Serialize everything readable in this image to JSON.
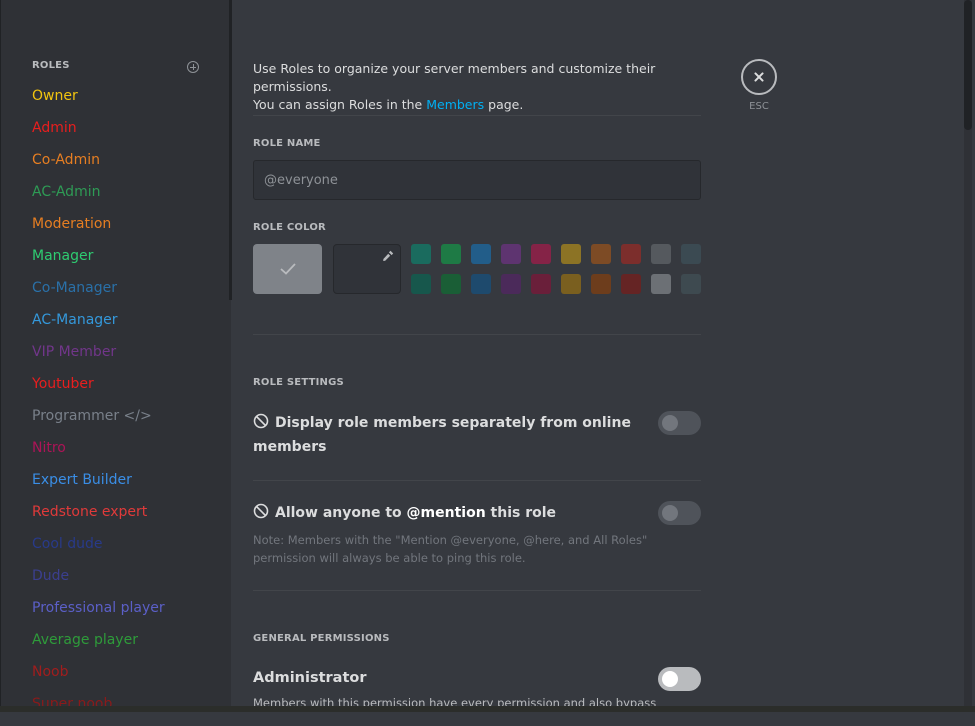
{
  "sidebar": {
    "header": "ROLES",
    "roles": [
      {
        "name": "Owner",
        "color": "#f1c40f"
      },
      {
        "name": "Admin",
        "color": "#e91e1e"
      },
      {
        "name": "Co-Admin",
        "color": "#e67e22"
      },
      {
        "name": "AC-Admin",
        "color": "#2e9b55"
      },
      {
        "name": "Moderation",
        "color": "#e67e22"
      },
      {
        "name": "Manager",
        "color": "#2ecc71"
      },
      {
        "name": "Co-Manager",
        "color": "#2a70a8"
      },
      {
        "name": "AC-Manager",
        "color": "#3498db"
      },
      {
        "name": "VIP Member",
        "color": "#71368a"
      },
      {
        "name": "Youtuber",
        "color": "#e91e1e"
      },
      {
        "name": "Programmer </>",
        "color": "#79808a"
      },
      {
        "name": "Nitro",
        "color": "#ad1457"
      },
      {
        "name": "Expert Builder",
        "color": "#3a8ee6"
      },
      {
        "name": "Redstone expert",
        "color": "#e03a3a"
      },
      {
        "name": "Cool dude",
        "color": "#283a8a"
      },
      {
        "name": "Dude",
        "color": "#3b3f8f"
      },
      {
        "name": "Professional player",
        "color": "#5b5fc7"
      },
      {
        "name": "Average player",
        "color": "#2e9b3a"
      },
      {
        "name": "Noob",
        "color": "#a11d1d"
      },
      {
        "name": "Super noob",
        "color": "#8a1a1a"
      }
    ]
  },
  "intro": {
    "line1": "Use Roles to organize your server members and customize their permissions.",
    "line2_pre": "You can assign Roles in the ",
    "link": "Members",
    "line2_post": " page."
  },
  "role_name": {
    "label": "ROLE NAME",
    "value": "@everyone"
  },
  "role_color": {
    "label": "ROLE COLOR",
    "default_color": "#7f8389",
    "swatches_top": [
      "#1a6b5e",
      "#1e7a45",
      "#225d89",
      "#5e3470",
      "#852347",
      "#8c7325",
      "#7d4b25",
      "#7c2e2c",
      "#55595e",
      "#3b4a52"
    ],
    "swatches_bottom": [
      "#17574c",
      "#1a5e36",
      "#1e4a6d",
      "#4b2a5a",
      "#6a1f3a",
      "#7a5f1f",
      "#6d3d1c",
      "#652424",
      "#6c7075",
      "#3e4a50"
    ]
  },
  "role_settings": {
    "label": "ROLE SETTINGS",
    "hoist": {
      "line1": "Display role members separately from online",
      "line2": "members",
      "enabled": false
    },
    "mention": {
      "pre": "Allow anyone to ",
      "strong": "@mention",
      "post": " this role",
      "note1": "Note: Members with the \"Mention @everyone, @here, and All Roles\"",
      "note2": "permission will always be able to ping this role.",
      "enabled": false
    }
  },
  "general_permissions": {
    "label": "GENERAL PERMISSIONS",
    "admin": {
      "title": "Administrator",
      "desc": "Members with this permission have every permission and also bypass",
      "enabled": false
    }
  },
  "close": {
    "label": "ESC"
  }
}
